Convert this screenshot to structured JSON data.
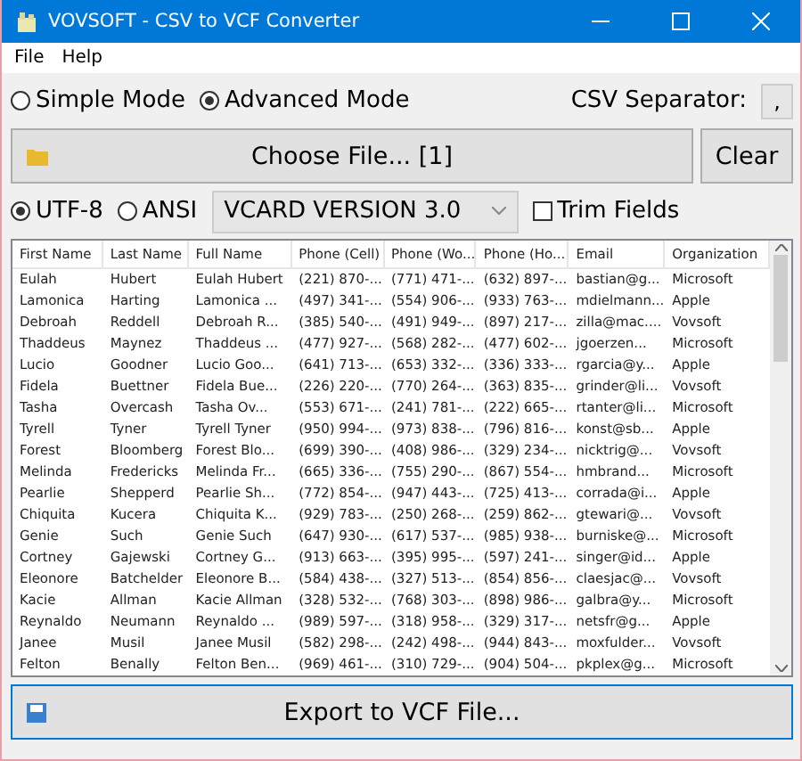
{
  "window": {
    "title": "VOVSOFT - CSV to VCF Converter"
  },
  "menu": [
    "File",
    "Help"
  ],
  "modes": [
    {
      "label": "Simple Mode",
      "selected": false
    },
    {
      "label": "Advanced Mode",
      "selected": true
    }
  ],
  "separator": {
    "label": "CSV Separator:",
    "value": ","
  },
  "choose_button": "Choose File... [1]",
  "clear_button": "Clear",
  "encodings": [
    {
      "label": "UTF-8",
      "selected": true
    },
    {
      "label": "ANSI",
      "selected": false
    }
  ],
  "version_select": "VCARD VERSION 3.0",
  "trim_fields": {
    "label": "Trim Fields",
    "checked": false
  },
  "table": {
    "columns": [
      "First Name",
      "Last Name",
      "Full Name",
      "Phone (Cell)",
      "Phone (Wo...",
      "Phone (Ho...",
      "Email",
      "Organization"
    ],
    "rows": [
      [
        "Eulah",
        "Hubert",
        "Eulah Hubert",
        "(221) 870-...",
        "(771) 471-...",
        "(632) 897-...",
        "bastian@g...",
        "Microsoft"
      ],
      [
        "Lamonica",
        "Harting",
        "Lamonica ...",
        "(497) 341-...",
        "(554) 906-...",
        "(933) 763-...",
        "mdielmann...",
        "Apple"
      ],
      [
        "Debroah",
        "Reddell",
        "Debroah R...",
        "(385) 540-...",
        "(491) 949-...",
        "(897) 217-...",
        "zilla@mac....",
        "Vovsoft"
      ],
      [
        "Thaddeus",
        "Maynez",
        "Thaddeus ...",
        "(477) 927-...",
        "(568) 282-...",
        "(477) 602-...",
        "jgoerzen...",
        "Microsoft"
      ],
      [
        "Lucio",
        "Goodner",
        "Lucio Goo...",
        "(641) 713-...",
        "(653) 332-...",
        "(336) 333-...",
        "rgarcia@y...",
        "Apple"
      ],
      [
        "Fidela",
        "Buettner",
        "Fidela Bue...",
        "(226) 220-...",
        "(770) 264-...",
        "(363) 835-...",
        "grinder@li...",
        "Vovsoft"
      ],
      [
        "Tasha",
        "Overcash",
        "Tasha Ov...",
        "(553) 671-...",
        "(241) 781-...",
        "(222) 665-...",
        "rtanter@li...",
        "Microsoft"
      ],
      [
        "Tyrell",
        "Tyner",
        "Tyrell Tyner",
        "(950) 994-...",
        "(973) 838-...",
        "(796) 816-...",
        "konst@sb...",
        "Apple"
      ],
      [
        "Forest",
        "Bloomberg",
        "Forest Blo...",
        "(699) 390-...",
        "(408) 986-...",
        "(329) 234-...",
        "nicktrig@...",
        "Vovsoft"
      ],
      [
        "Melinda",
        "Fredericks",
        "Melinda Fr...",
        "(665) 336-...",
        "(755) 290-...",
        "(867) 554-...",
        "hmbrand...",
        "Microsoft"
      ],
      [
        "Pearlie",
        "Shepperd",
        "Pearlie Sh...",
        "(772) 854-...",
        "(947) 443-...",
        "(725) 413-...",
        "corrada@i...",
        "Apple"
      ],
      [
        "Chiquita",
        "Kucera",
        "Chiquita K...",
        "(929) 783-...",
        "(250) 268-...",
        "(259) 862-...",
        "gtewari@...",
        "Vovsoft"
      ],
      [
        "Genie",
        "Such",
        "Genie Such",
        "(647) 930-...",
        "(617) 537-...",
        "(985) 938-...",
        "burniske@...",
        "Microsoft"
      ],
      [
        "Cortney",
        "Gajewski",
        "Cortney G...",
        "(913) 663-...",
        "(395) 995-...",
        "(597) 241-...",
        "singer@id...",
        "Apple"
      ],
      [
        "Eleonore",
        "Batchelder",
        "Eleonore B...",
        "(584) 438-...",
        "(327) 513-...",
        "(854) 856-...",
        "claesjac@...",
        "Vovsoft"
      ],
      [
        "Kacie",
        "Allman",
        "Kacie Allman",
        "(328) 532-...",
        "(768) 303-...",
        "(898) 986-...",
        "galbra@y...",
        "Microsoft"
      ],
      [
        "Reynaldo",
        "Neumann",
        "Reynaldo ...",
        "(989) 597-...",
        "(318) 958-...",
        "(329) 317-...",
        "netsfr@g...",
        "Apple"
      ],
      [
        "Janee",
        "Musil",
        "Janee Musil",
        "(582) 298-...",
        "(242) 498-...",
        "(944) 843-...",
        "moxfulder...",
        "Vovsoft"
      ],
      [
        "Felton",
        "Benally",
        "Felton Ben...",
        "(969) 461-...",
        "(310) 729-...",
        "(904) 504-...",
        "pkplex@g...",
        "Microsoft"
      ]
    ]
  },
  "export_button": "Export to VCF File..."
}
